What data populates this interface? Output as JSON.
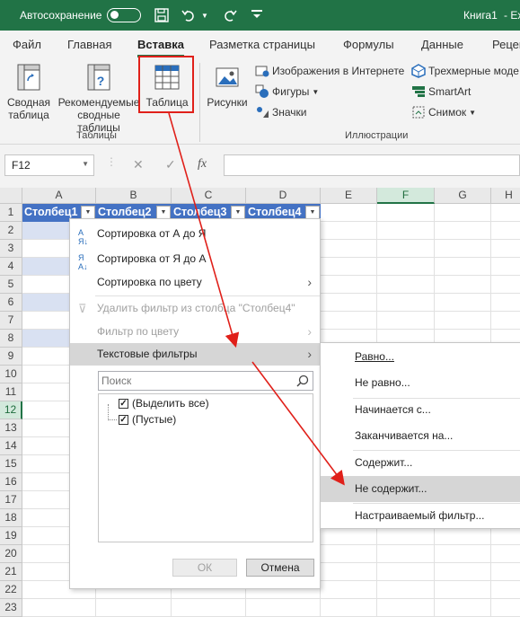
{
  "titlebar": {
    "autosave_label": "Автосохранение",
    "doc_title": "Книга1",
    "doc_more": "- Ех"
  },
  "tabs": [
    "Файл",
    "Главная",
    "Вставка",
    "Разметка страницы",
    "Формулы",
    "Данные",
    "Рецен"
  ],
  "ribbon": {
    "pivot_label": "Сводная таблица",
    "recommended_label": "Рекомендуемые сводные таблицы",
    "table_label": "Таблица",
    "pictures_label": "Рисунки",
    "online_images_label": "Изображения в Интернете",
    "shapes_label": "Фигуры",
    "icons_label": "Значки",
    "models3d_label": "Трехмерные моде",
    "smartart_label": "SmartArt",
    "screenshot_label": "Снимок",
    "group_tables": "Таблицы",
    "group_illustrations": "Иллюстрации"
  },
  "formula_bar": {
    "name_box": "F12",
    "fx": "fx"
  },
  "columns": [
    "A",
    "B",
    "C",
    "D",
    "E",
    "F",
    "G",
    "H"
  ],
  "rows": [
    "1",
    "2",
    "3",
    "4",
    "5",
    "6",
    "7",
    "8",
    "9",
    "10",
    "11",
    "12",
    "13",
    "14",
    "15",
    "16",
    "17",
    "18",
    "19",
    "20",
    "21",
    "22",
    "23"
  ],
  "table_headers": [
    "Столбец1",
    "Столбец2",
    "Столбец3",
    "Столбец4"
  ],
  "filter_menu": {
    "sort_az": "Сортировка от А до Я",
    "sort_za": "Сортировка от Я до А",
    "sort_color": "Сортировка по цвету",
    "clear_filter": "Удалить фильтр из столбца \"Столбец4\"",
    "filter_color": "Фильтр по цвету",
    "text_filters": "Текстовые фильтры",
    "search_placeholder": "Поиск",
    "select_all": "(Выделить все)",
    "blanks": "(Пустые)",
    "ok": "ОК",
    "cancel": "Отмена"
  },
  "text_filters_submenu": [
    "Равно...",
    "Не равно...",
    "Начинается с...",
    "Заканчивается на...",
    "Содержит...",
    "Не содержит...",
    "Настраиваемый фильтр..."
  ],
  "colors": {
    "excel_green": "#217346",
    "table_header": "#4472c4",
    "table_band": "#d9e1f2",
    "annotation_red": "#e0201a"
  }
}
